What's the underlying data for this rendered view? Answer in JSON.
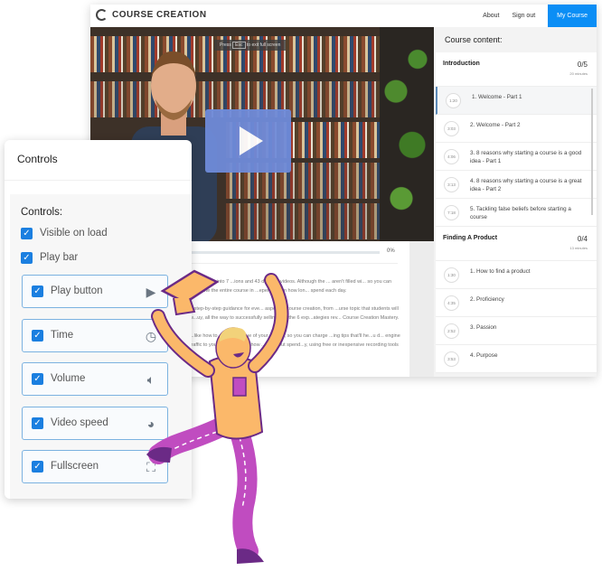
{
  "site": {
    "logo": "COURSE CREATION",
    "nav": [
      "About",
      "Sign out"
    ],
    "cta": "My Course"
  },
  "video": {
    "overlay_press": "Press",
    "overlay_key": "Esc",
    "overlay_rest": "to exit full screen",
    "progress_label": "0%",
    "progress": 0
  },
  "description": [
    "...ken down into 7 ...ions and 43 detailed videos. Although the ... aren't filled wi... so you can complete the entire course in ...epending on how lon... spend each day.",
    "...step-by-step guidance for eve... aspect of course creation, from ...urse topic that students will w...uy, all the way to successfully selling ...of the 6 exp...ategies rev... Course Creation Mastery.",
    "...like how to ...e per... value of your course, so you can charge ...ing tips that'll he...u d... engine traffic to your sales page ... how ...e without spend...y, using free or inexpensive recording tools"
  ],
  "sidebar": {
    "title": "Course content:",
    "sections": [
      {
        "title": "Introduction",
        "count": "0/5",
        "minutes": "20 minutes",
        "lessons": [
          {
            "dur": "1:20",
            "title": "1. Welcome - Part 1",
            "active": true
          },
          {
            "dur": "3:03",
            "title": "2. Welcome - Part 2"
          },
          {
            "dur": "4:06",
            "title": "3. 8 reasons why starting a course is a good idea - Part 1"
          },
          {
            "dur": "3:13",
            "title": "4. 8 reasons why starting a course is a great idea - Part 2"
          },
          {
            "dur": "7:18",
            "title": "5. Tackling false beliefs before starting a course"
          }
        ]
      },
      {
        "title": "Finding A Product",
        "count": "0/4",
        "minutes": "13 minutes",
        "lessons": [
          {
            "dur": "1:30",
            "title": "1. How to find a product"
          },
          {
            "dur": "4:35",
            "title": "2. Proficiency"
          },
          {
            "dur": "2:52",
            "title": "3. Passion"
          },
          {
            "dur": "3:53",
            "title": "4. Purpose"
          }
        ]
      }
    ]
  },
  "controls": {
    "title": "Controls",
    "label": "Controls:",
    "visible_on_load": "Visible on load",
    "play_bar": "Play bar",
    "items": [
      {
        "label": "Play button",
        "icon": "play-icon"
      },
      {
        "label": "Time",
        "icon": "clock-icon"
      },
      {
        "label": "Volume",
        "icon": "volume-icon"
      },
      {
        "label": "Video speed",
        "icon": "speed-icon"
      },
      {
        "label": "Fullscreen",
        "icon": "fullscreen-icon"
      }
    ]
  },
  "colors": {
    "accent": "#0b8ef5",
    "play": "#6f8bd9",
    "checkbox": "#1b7fe0",
    "skin": "#fbb86a",
    "purple": "#6b2a86",
    "pants": "#c04cc0"
  }
}
